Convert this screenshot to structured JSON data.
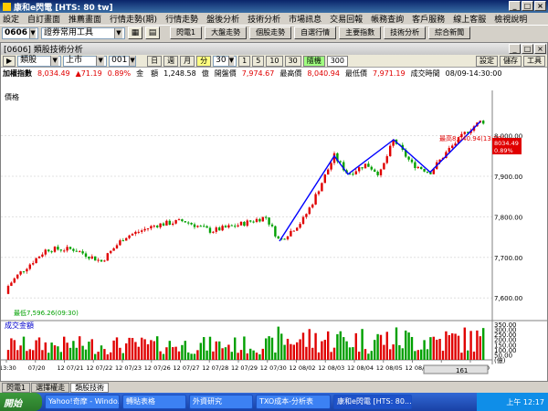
{
  "window": {
    "title": "康和e閃電 [HTS: 80 tw]"
  },
  "menu": [
    "設定",
    "自訂畫面",
    "推薦畫面",
    "行情走勢(期)",
    "行情走勢",
    "盤後分析",
    "技術分析",
    "市場訊息",
    "交易回報",
    "帳務查詢",
    "客戶服務",
    "線上客服",
    "檢視說明"
  ],
  "toolbar": {
    "code": "0606",
    "tools_label": "證券常用工具",
    "buttons": [
      "閃電1",
      "大盤走勢",
      "個股走勢",
      "自選行情",
      "主要指數",
      "技術分析",
      "綜合新聞"
    ]
  },
  "pane": {
    "title": "[0606] 類股技術分析",
    "ctrl": {
      "category": "類股",
      "market": "上市",
      "code": "001",
      "periods": [
        "日",
        "週",
        "月",
        "分"
      ],
      "interval": "30",
      "steps": [
        "1",
        "5",
        "10",
        "30"
      ],
      "mode": "隨機",
      "count": "300",
      "right_buttons": [
        "設定",
        "儲存",
        "工具"
      ]
    },
    "info": {
      "name": "加權指數",
      "value": "8,034.49",
      "change": "▲71.19",
      "pct": "0.89%",
      "amount_label": "金　額",
      "amount": "1,248.58",
      "unit": "億",
      "open_label": "開盤價",
      "open": "7,974.67",
      "high_label": "最高價",
      "high": "8,040.94",
      "low_label": "最低價",
      "low": "7,971.19",
      "time_label": "成交時間",
      "time": "08/09-14:30:00"
    }
  },
  "chart_data": {
    "type": "candlestick",
    "price_label": "價格",
    "volume_label": "成交金額",
    "y_price_ticks": [
      "8,000.00",
      "7,900.00",
      "7,800.00",
      "7,700.00",
      "7,600.00"
    ],
    "y_volume_ticks": [
      "350.00",
      "300.00",
      "250.00",
      "200.00",
      "150.00",
      "100.00",
      "50.00"
    ],
    "volume_unit": "(億)",
    "x_labels": [
      "13:30",
      "07/20",
      "12 07/21",
      "12 07/22",
      "12 07/23",
      "12 07/26",
      "12 07/27",
      "12 07/28",
      "12 07/29",
      "12 07/30",
      "12 08/02",
      "12 08/03",
      "12 08/04",
      "12 08/05",
      "12 08/06",
      "12 08/09",
      "12 13:30"
    ],
    "high_annotation": "最高8,040.94(13:30)",
    "low_annotation": "最低7,596.26(09:30)",
    "last_badge": [
      "8034.49",
      "0.89%"
    ],
    "colors": {
      "up": "#e00000",
      "down": "#00a000",
      "trend": "#0000ff"
    },
    "scrollbar_counter": "161",
    "price_range": [
      7560,
      8080
    ]
  },
  "tabs": [
    "閃電1",
    "選擇權走",
    "類股技術"
  ],
  "taskbar": {
    "start": "開始",
    "tasks": [
      "Yahoo!奇摩 - Windo...",
      "轉貼表格",
      "外資研究",
      "TXO成本-分析表",
      "康和e閃電 [HTS: 80..."
    ],
    "clock": "上午 12:17"
  }
}
